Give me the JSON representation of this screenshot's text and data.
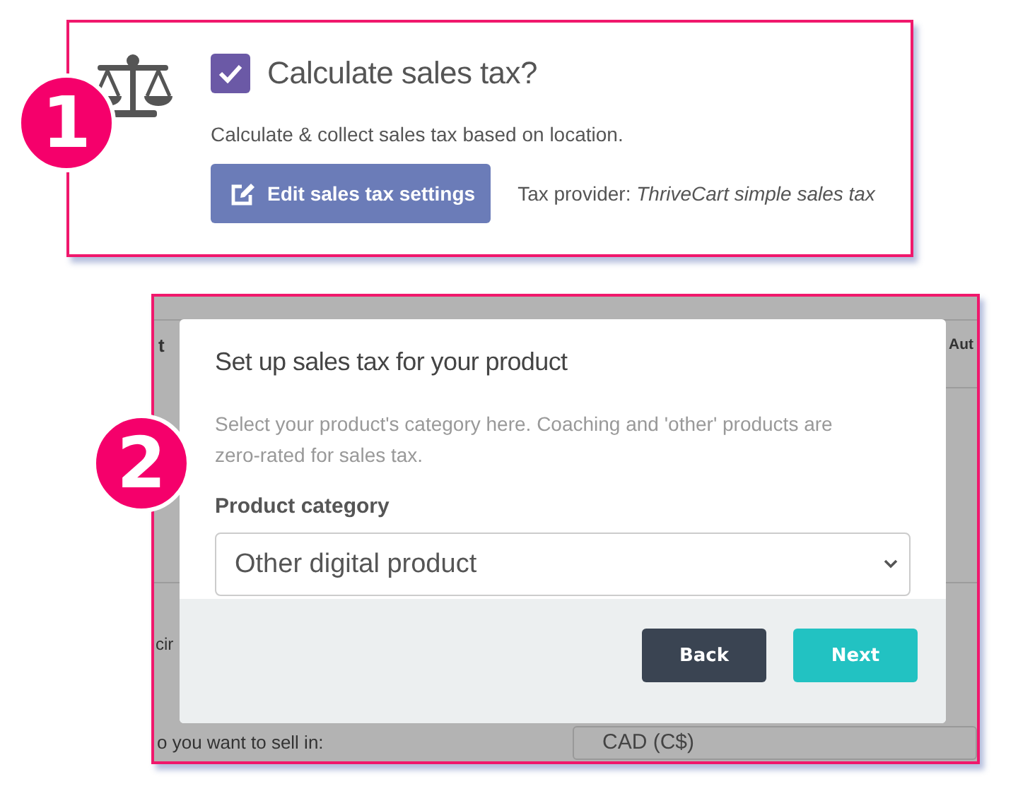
{
  "panel_1": {
    "badge": "1",
    "checkbox": {
      "label": "Calculate sales tax?",
      "checked": true
    },
    "description": "Calculate & collect sales tax based on location.",
    "edit_button": "Edit sales tax settings",
    "provider": "Tax provider: *ThriveCart simple sales tax*"
  },
  "panel_2": {
    "badge": "2",
    "background": {
      "column_1": "t",
      "column_2": "Aut",
      "label_1": "cir",
      "label_2": "o you want to sell in:",
      "currency_field": "CAD (C$)"
    },
    "modal": {
      "title": "Set up sales tax for your product",
      "description": "Select your product's category here. Coaching and 'other' products are zero-rated for sales tax.",
      "field_label": "Product category",
      "select_value": "Other digital product",
      "buttons": [
        {
          "label": "Back",
          "kind": "secondary"
        },
        {
          "label": "Next",
          "kind": "primary"
        }
      ]
    }
  }
}
